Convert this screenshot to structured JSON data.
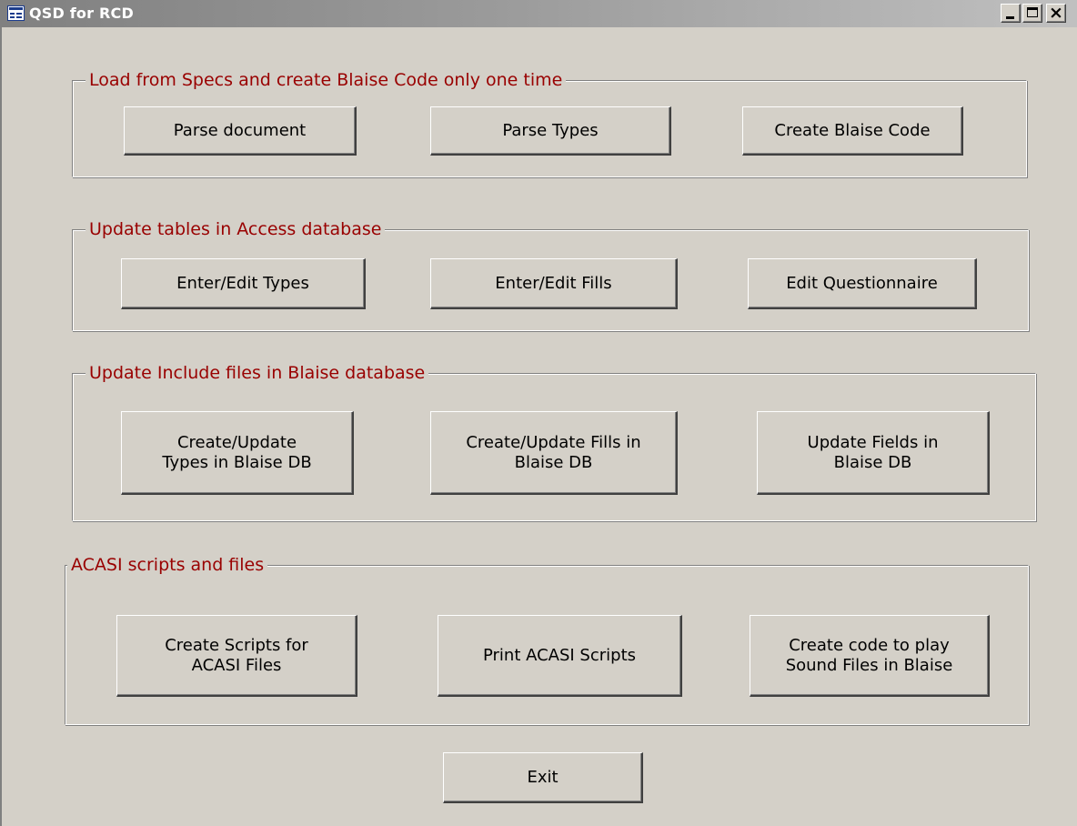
{
  "window": {
    "title": "QSD for RCD",
    "icon": "form-icon",
    "controls": {
      "minimize": "minimize-icon",
      "maximize": "maximize-icon",
      "close": "close-icon"
    }
  },
  "colors": {
    "face": "#d4d0c8",
    "group_label": "#990000",
    "titlebar": "#808080"
  },
  "groups": [
    {
      "label": "Load from Specs and create Blaise Code only one  time",
      "buttons": [
        "Parse document",
        "Parse Types",
        "Create Blaise Code"
      ]
    },
    {
      "label": "Update tables in Access database",
      "buttons": [
        "Enter/Edit Types",
        "Enter/Edit Fills",
        "Edit Questionnaire"
      ]
    },
    {
      "label": "Update Include files in Blaise database",
      "buttons": [
        [
          "Create/Update",
          "Types in Blaise DB"
        ],
        [
          "Create/Update Fills in",
          "Blaise DB"
        ],
        [
          "Update Fields in",
          "Blaise DB"
        ]
      ]
    },
    {
      "label": "ACASI scripts and files",
      "buttons": [
        [
          "Create Scripts for",
          "ACASI Files"
        ],
        "Print ACASI Scripts",
        [
          "Create code to play",
          "Sound Files in Blaise"
        ]
      ]
    }
  ],
  "exit_label": "Exit"
}
